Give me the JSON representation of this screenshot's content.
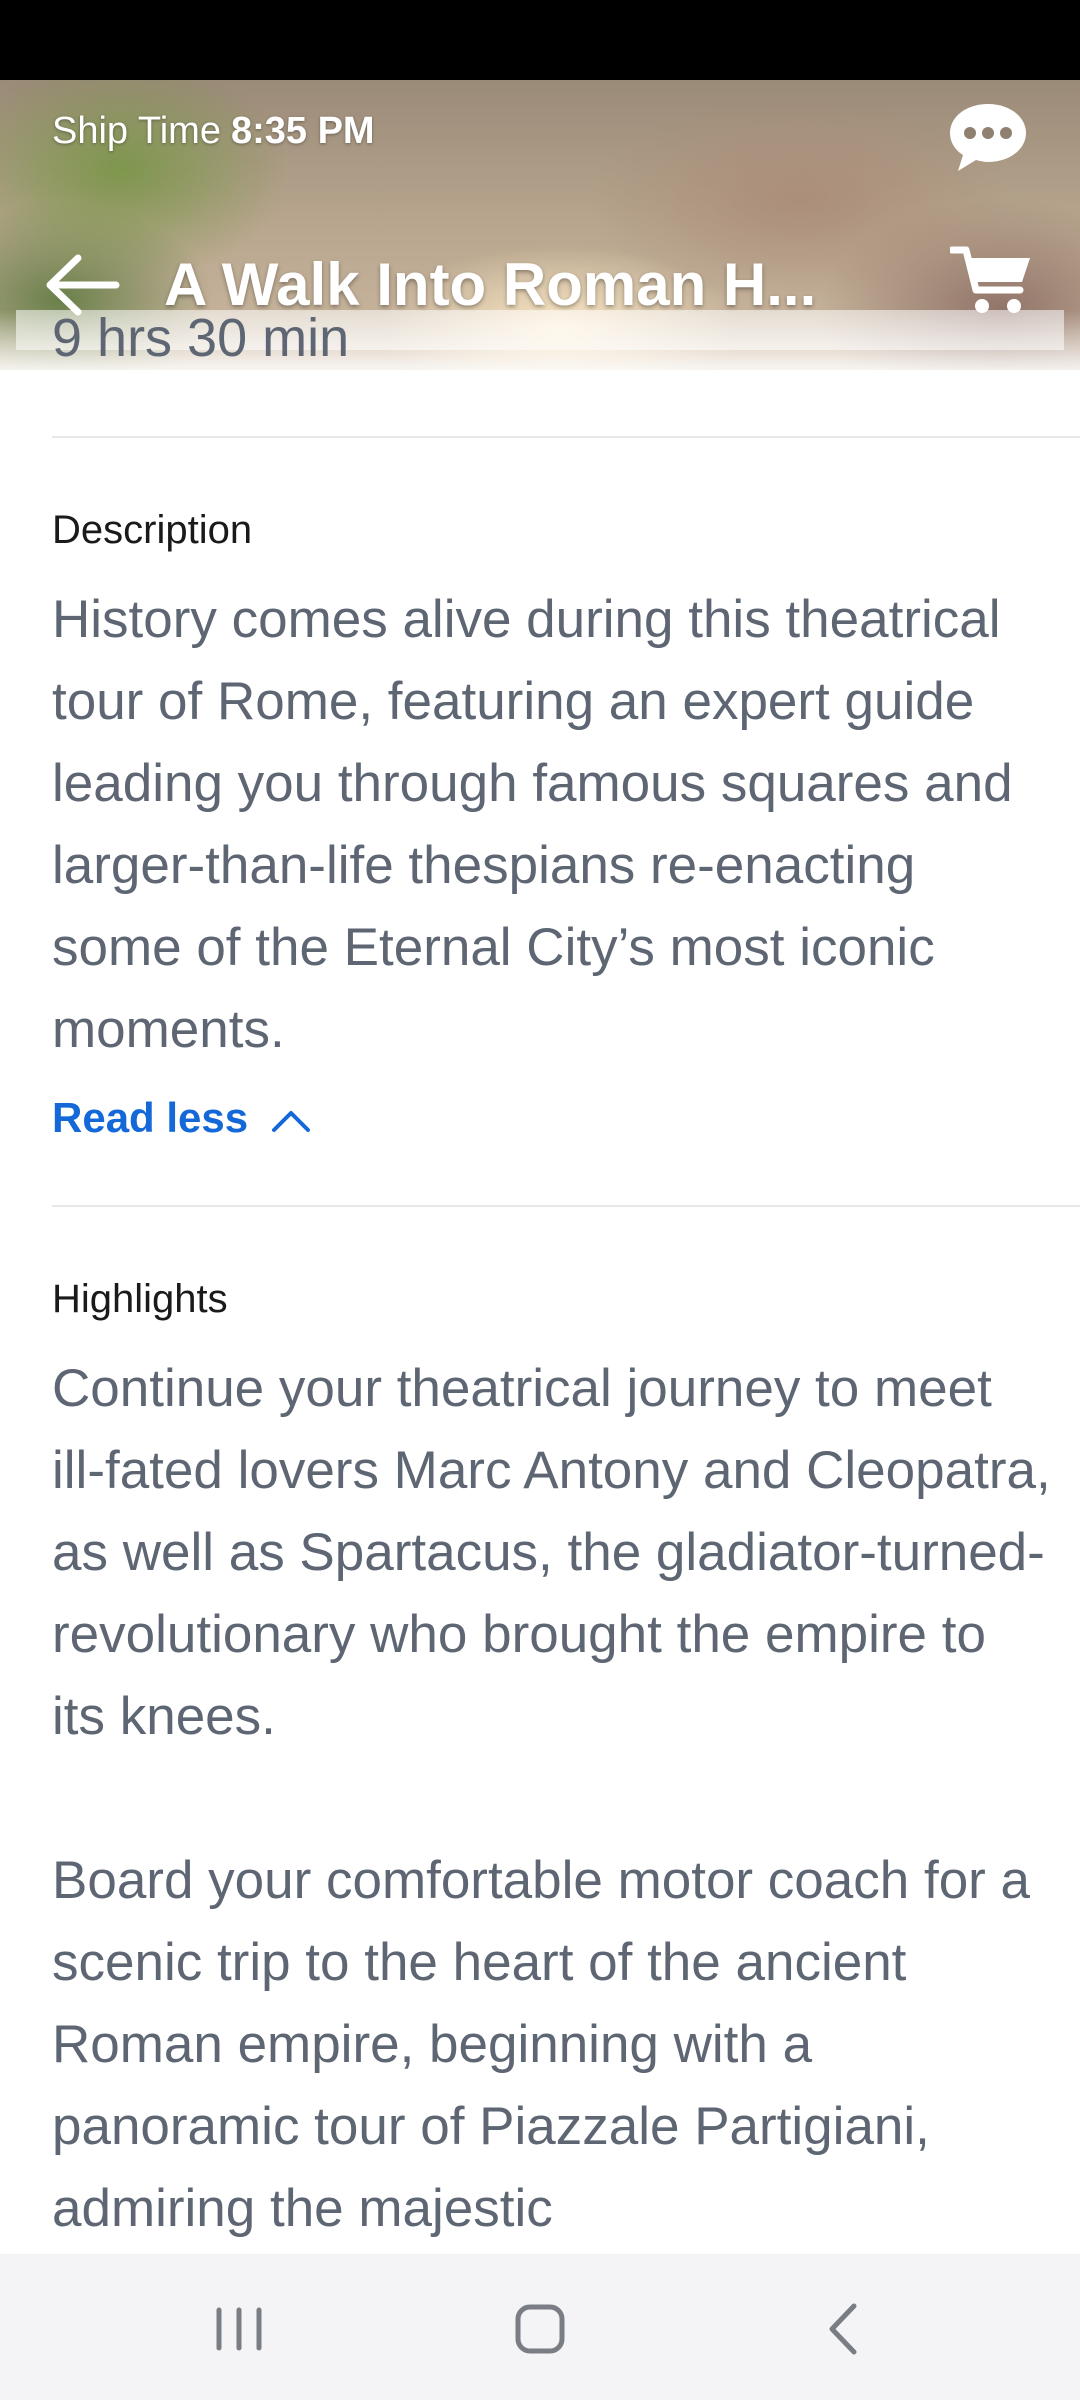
{
  "header": {
    "ship_time_label": "Ship Time",
    "ship_time_value": "8:35 PM",
    "title": "A Walk Into Roman H...",
    "duration": "9 hrs 30 min",
    "icons": [
      "chat-icon",
      "back-arrow-icon",
      "cart-icon"
    ]
  },
  "description": {
    "heading": "Description",
    "text": "History comes alive during this theatrical tour of Rome, featuring an expert guide leading you through famous squares and larger-than-life thespians re-enacting some of the Eternal City’s most iconic moments.",
    "toggle_label": "Read less"
  },
  "highlights": {
    "heading": "Highlights",
    "paragraph_1": "Continue your theatrical journey to meet ill-fated lovers Marc Antony and Cleopatra, as well as Spartacus, the gladiator-turned-revolutionary who brought the empire to its knees.",
    "paragraph_2": "Board your comfortable motor coach for a scenic trip to the heart of the ancient Roman empire, beginning with a panoramic tour of Piazzale Partigiani, admiring the majestic"
  },
  "nav_bar": {
    "icons": [
      "recent-apps-icon",
      "home-icon",
      "back-icon"
    ]
  },
  "colors": {
    "link": "#1468d8",
    "body_text": "#5d6672",
    "heading": "#1a1a1a",
    "nav_background": "#f4f4f6"
  }
}
